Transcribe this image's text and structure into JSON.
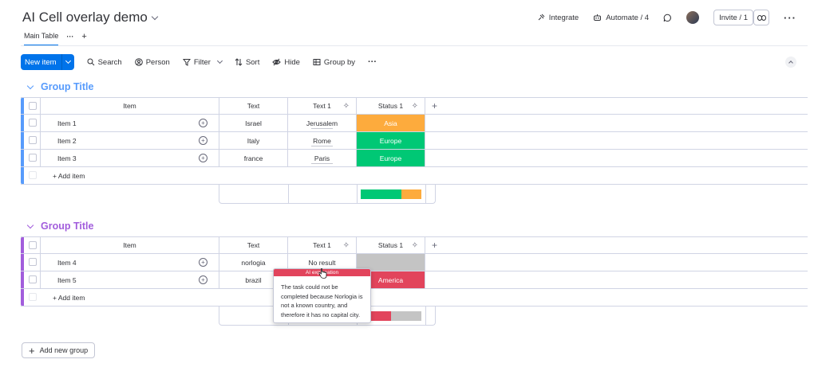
{
  "header": {
    "board_title": "AI Cell overlay demo",
    "integrate": "Integrate",
    "automate": "Automate / 4",
    "invite": "Invite / 1"
  },
  "tabs": {
    "main": "Main Table",
    "more": "···",
    "add": "+"
  },
  "toolbar": {
    "new_item": "New item",
    "search": "Search",
    "person": "Person",
    "filter": "Filter",
    "sort": "Sort",
    "hide": "Hide",
    "group_by": "Group by",
    "more": "···"
  },
  "columns": {
    "item": "Item",
    "text": "Text",
    "text1": "Text 1",
    "status1": "Status 1"
  },
  "colors": {
    "blue": "#0073ea",
    "group1": "#579bfc",
    "group2": "#a25ddc",
    "orange": "#fdab3d",
    "green": "#00c875",
    "red": "#e2445c",
    "grey": "#c4c4c4"
  },
  "groups": [
    {
      "title": "Group Title",
      "color": "#579bfc",
      "add_item": "+ Add item",
      "rows": [
        {
          "item": "Item 1",
          "text": "Israel",
          "text1": "Jerusalem",
          "status": "Asia",
          "status_color": "#fdab3d"
        },
        {
          "item": "Item 2",
          "text": "Italy",
          "text1": "Rome",
          "status": "Europe",
          "status_color": "#00c875"
        },
        {
          "item": "Item 3",
          "text": "france",
          "text1": "Paris",
          "status": "Europe",
          "status_color": "#00c875"
        }
      ],
      "summary": [
        {
          "fraction": 0.67,
          "color": "#00c875"
        },
        {
          "fraction": 0.33,
          "color": "#fdab3d"
        }
      ]
    },
    {
      "title": "Group Title",
      "color": "#a25ddc",
      "add_item": "+ Add item",
      "rows": [
        {
          "item": "Item 4",
          "text": "norlogia",
          "text1": "No result",
          "status": "",
          "status_color": "#c4c4c4"
        },
        {
          "item": "Item 5",
          "text": "brazil",
          "text1": "",
          "status": "America",
          "status_color": "#e2445c"
        }
      ],
      "summary": [
        {
          "fraction": 0.5,
          "color": "#e2445c"
        },
        {
          "fraction": 0.5,
          "color": "#c4c4c4"
        }
      ]
    }
  ],
  "tooltip": {
    "title": "AI explanation",
    "body": "The task could not be completed because Norlogia is not a known country, and therefore it has no capital city."
  },
  "add_group": "Add new group"
}
